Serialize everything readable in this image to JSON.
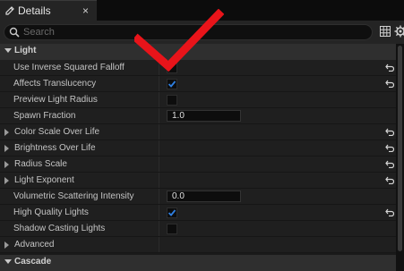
{
  "tab": {
    "title": "Details",
    "close": "×"
  },
  "search": {
    "placeholder": "Search"
  },
  "categories": [
    {
      "label": "Light"
    },
    {
      "label": "Cascade"
    }
  ],
  "rows": [
    {
      "label": "Use Inverse Squared Falloff",
      "type": "checkbox",
      "checked": false,
      "reset": true
    },
    {
      "label": "Affects Translucency",
      "type": "checkbox",
      "checked": true,
      "reset": true
    },
    {
      "label": "Preview Light Radius",
      "type": "checkbox",
      "checked": false,
      "reset": false
    },
    {
      "label": "Spawn Fraction",
      "type": "number",
      "value": "1.0",
      "reset": false
    },
    {
      "label": "Color Scale Over Life",
      "type": "group",
      "reset": true
    },
    {
      "label": "Brightness Over Life",
      "type": "group",
      "reset": true
    },
    {
      "label": "Radius Scale",
      "type": "group",
      "reset": true
    },
    {
      "label": "Light Exponent",
      "type": "group",
      "reset": true
    },
    {
      "label": "Volumetric Scattering Intensity",
      "type": "number",
      "value": "0.0",
      "reset": false
    },
    {
      "label": "High Quality Lights",
      "type": "checkbox",
      "checked": true,
      "reset": true
    },
    {
      "label": "Shadow Casting Lights",
      "type": "checkbox",
      "checked": false,
      "reset": false
    },
    {
      "label": "Advanced",
      "type": "group",
      "reset": false
    }
  ],
  "colors": {
    "accent": "#2f7fe0",
    "annotation": "#e8141a"
  },
  "icons": [
    "pencil-icon",
    "search-icon",
    "grid-icon",
    "gear-icon",
    "reset-arrow-icon",
    "checkmark-icon"
  ]
}
